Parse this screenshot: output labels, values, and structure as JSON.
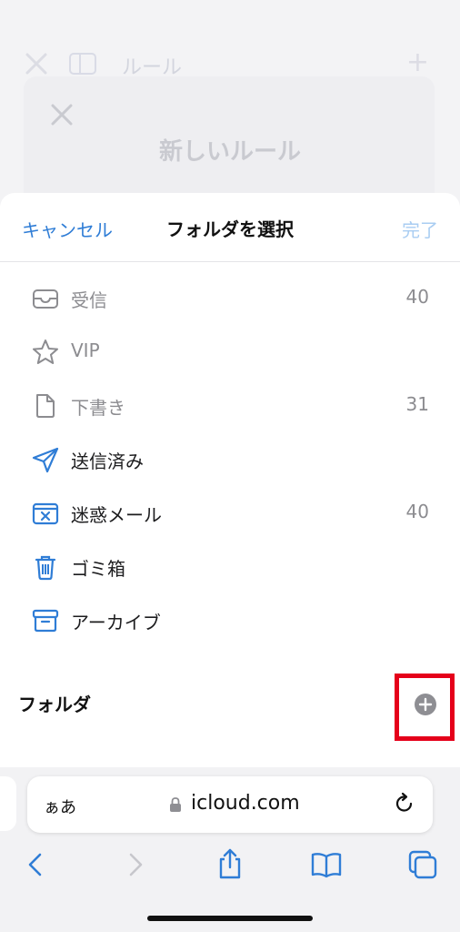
{
  "background": {
    "title": "ルール",
    "card_title": "新しいルール"
  },
  "sheet": {
    "cancel_label": "キャンセル",
    "title": "フォルダを選択",
    "done_label": "完了"
  },
  "folders": [
    {
      "label": "受信",
      "count": "40",
      "icon": "inbox-icon",
      "enabled": false
    },
    {
      "label": "VIP",
      "count": "",
      "icon": "star-icon",
      "enabled": false
    },
    {
      "label": "下書き",
      "count": "31",
      "icon": "draft-icon",
      "enabled": false
    },
    {
      "label": "送信済み",
      "count": "",
      "icon": "sent-icon",
      "enabled": true
    },
    {
      "label": "迷惑メール",
      "count": "40",
      "icon": "junk-icon",
      "enabled": true
    },
    {
      "label": "ゴミ箱",
      "count": "",
      "icon": "trash-icon",
      "enabled": true
    },
    {
      "label": "アーカイブ",
      "count": "",
      "icon": "archive-icon",
      "enabled": true
    }
  ],
  "section": {
    "title": "フォルダ",
    "add_icon": "plus-circle-icon"
  },
  "browser": {
    "aa_label": "ぁあ",
    "url": "icloud.com"
  },
  "colors": {
    "accent": "#2f7dd6",
    "accent_disabled": "#a9cdf2",
    "highlight": "#e5001a"
  }
}
